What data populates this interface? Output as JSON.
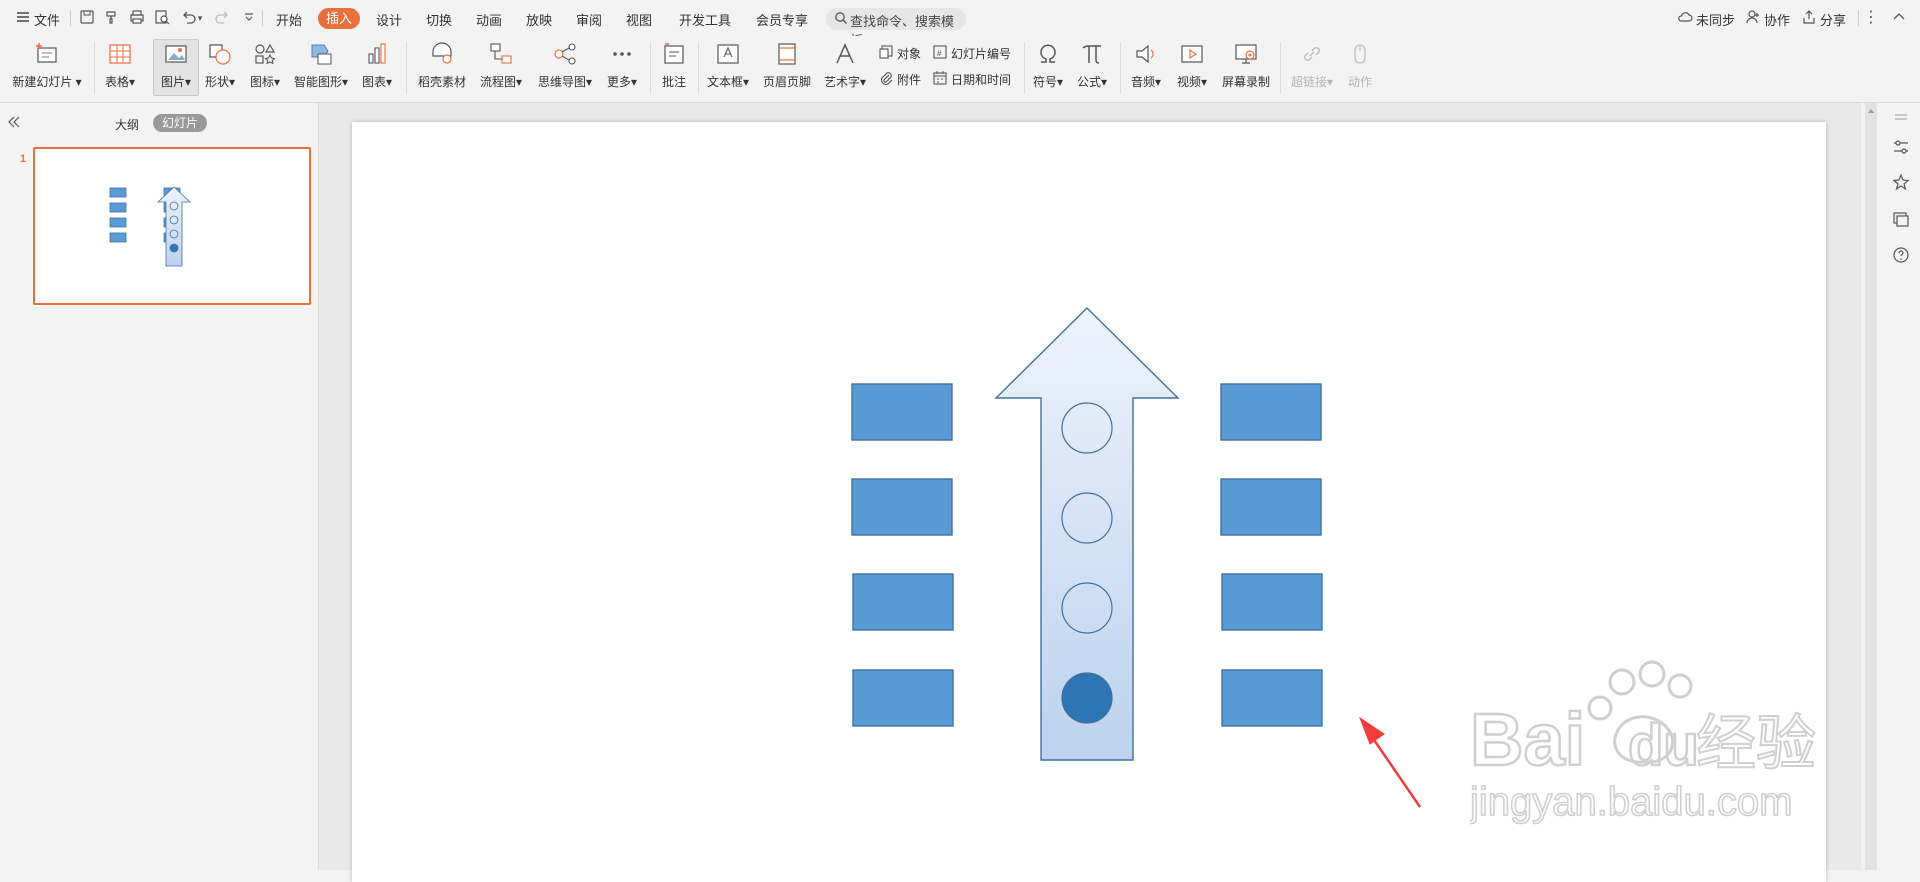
{
  "menu": {
    "file_label": "文件",
    "tabs": [
      "开始",
      "插入",
      "设计",
      "切换",
      "动画",
      "放映",
      "审阅",
      "视图",
      "开发工具",
      "会员专享"
    ],
    "search_placeholder": "查找命令、搜索模板",
    "right": {
      "sync": "未同步",
      "collab": "协作",
      "share": "分享"
    }
  },
  "ribbon": {
    "new_slide": "新建幻灯片",
    "table": "表格",
    "picture": "图片",
    "shape": "形状",
    "icon": "图标",
    "smart_art": "智能图形",
    "chart": "图表",
    "daoke": "稻壳素材",
    "flowchart": "流程图",
    "mindmap": "思维导图",
    "more": "更多",
    "comment": "批注",
    "textbox": "文本框",
    "header_footer": "页眉页脚",
    "wordart": "艺术字",
    "object": "对象",
    "slide_number": "幻灯片编号",
    "attachment": "附件",
    "datetime": "日期和时间",
    "symbol": "符号",
    "formula": "公式",
    "audio": "音频",
    "video": "视频",
    "screen_record": "屏幕录制",
    "hyperlink": "超链接",
    "action": "动作"
  },
  "left_panel": {
    "tab_outline": "大纲",
    "tab_slides": "幻灯片",
    "slide_index": "1"
  },
  "watermark": {
    "brand": "Bai",
    "brand2": "du",
    "chinese": "经验",
    "url": "jingyan.baidu.com"
  },
  "colors": {
    "accent": "#e96f3d",
    "rect_fill": "#5b9bd5",
    "rect_stroke": "#41719c",
    "arrow_stroke": "#41719c",
    "arrow_top": "#eef3fb",
    "arrow_bottom": "#bcd2ee",
    "dot_filled": "#2e75b6",
    "annotation_arrow": "#f03c3c"
  },
  "slide": {
    "circles_filled": [
      false,
      false,
      false,
      true
    ]
  }
}
